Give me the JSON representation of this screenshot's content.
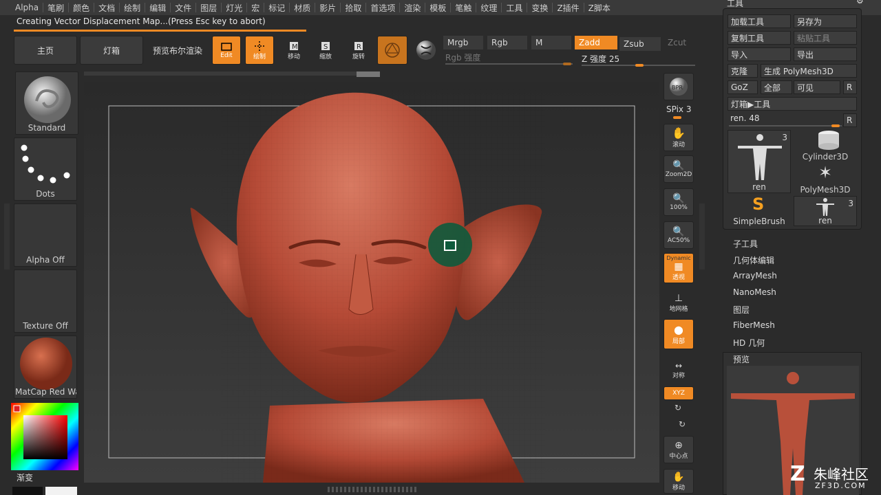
{
  "menubar": [
    "Alpha",
    "笔刷",
    "颜色",
    "文档",
    "绘制",
    "编辑",
    "文件",
    "图层",
    "灯光",
    "宏",
    "标记",
    "材质",
    "影片",
    "拾取",
    "首选项",
    "渲染",
    "模板",
    "笔触",
    "纹理",
    "工具",
    "变换",
    "Z插件",
    "Z脚本"
  ],
  "status_text": "Creating Vector Displacement Map...(Press Esc key to abort)",
  "toolbar": {
    "home": "主页",
    "lightbox": "灯箱",
    "preview_render": "预览布尔渲染",
    "edit": "Edit",
    "draw": "绘制",
    "move": "移动",
    "scale": "缩放",
    "rotate": "旋转",
    "mrgb": "Mrgb",
    "rgb": "Rgb",
    "m": "M",
    "rgb_intensity": "Rgb 强度",
    "zadd": "Zadd",
    "zsub": "Zsub",
    "zcut": "Zcut",
    "z_intensity": "Z 强度 25"
  },
  "left_shelf": {
    "brush": "Standard",
    "stroke": "Dots",
    "alpha": "Alpha Off",
    "texture": "Texture Off",
    "material": "MatCap Red Wax",
    "gradient": "渐变"
  },
  "right_shelf": {
    "bpr": "BPR",
    "spix": "SPix 3",
    "scroll": "滚动",
    "zoom2d": "Zoom2D",
    "pct100": "100%",
    "ac50": "AC50%",
    "dynamic": "Dynamic",
    "persp": "透视",
    "floor": "地网格",
    "local": "局部",
    "sym": "对称",
    "xyz": "XYZ",
    "center": "中心点",
    "move": "移动"
  },
  "tool_panel": {
    "title": "工具",
    "load": "加载工具",
    "save_as": "另存为",
    "copy": "复制工具",
    "paste": "粘贴工具",
    "import": "导入",
    "export": "导出",
    "clone": "克隆",
    "make_polymesh": "生成 PolyMesh3D",
    "goz": "GoZ",
    "all": "全部",
    "visible": "可见",
    "r": "R",
    "lightbox_tool": "灯箱▶工具",
    "current": "ren. 48",
    "thumbs": [
      {
        "label": "ren",
        "count": "3"
      },
      {
        "label": "Cylinder3D"
      },
      {
        "label": "PolyMesh3D"
      },
      {
        "label": "SimpleBrush"
      },
      {
        "label": "ren",
        "count": "3"
      }
    ]
  },
  "subpanels": [
    "子工具",
    "几何体编辑",
    "ArrayMesh",
    "NanoMesh",
    "图层",
    "FiberMesh",
    "HD 几何"
  ],
  "preview_label": "预览",
  "watermark": {
    "brand": "朱峰社区",
    "site": "ZF3D.COM"
  }
}
